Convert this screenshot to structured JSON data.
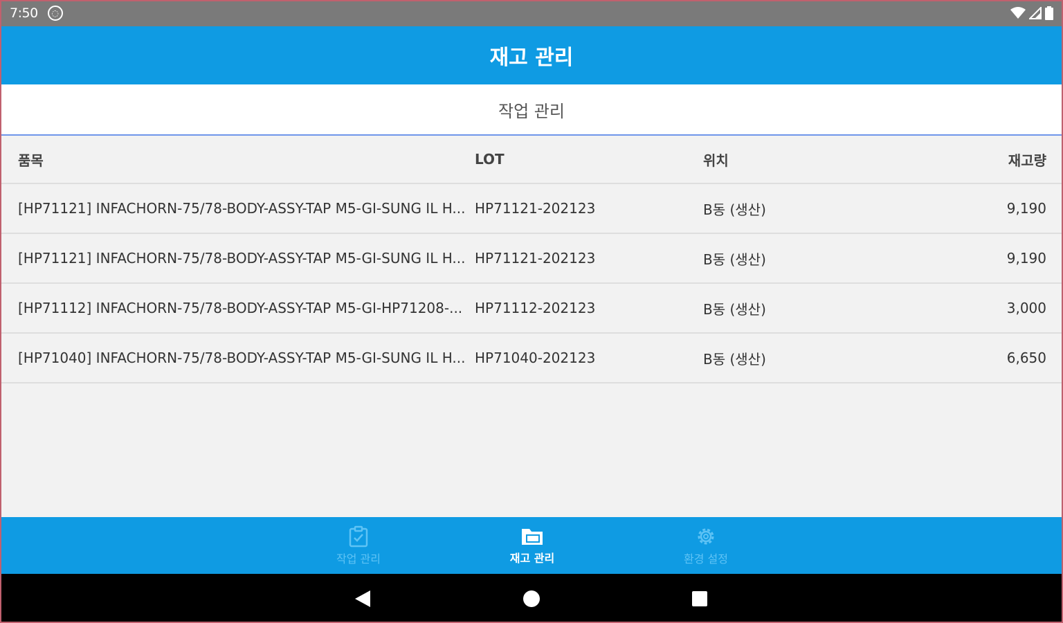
{
  "status_bar": {
    "time": "7:50",
    "notification_icon": "circle-app-icon",
    "icons": [
      "wifi-icon",
      "signal-icon",
      "battery-icon"
    ]
  },
  "app_bar": {
    "title": "재고 관리"
  },
  "sub_header": {
    "label": "작업 관리"
  },
  "table": {
    "headers": {
      "item": "품목",
      "lot": "LOT",
      "location": "위치",
      "quantity": "재고량"
    },
    "rows": [
      {
        "item": "[HP71121] INFACHORN-75/78-BODY-ASSY-TAP M5-GI-SUNG IL H...",
        "lot": "HP71121-202123",
        "location": "B동 (생산)",
        "quantity": "9,190"
      },
      {
        "item": "[HP71121] INFACHORN-75/78-BODY-ASSY-TAP M5-GI-SUNG IL H...",
        "lot": "HP71121-202123",
        "location": "B동 (생산)",
        "quantity": "9,190"
      },
      {
        "item": "[HP71112] INFACHORN-75/78-BODY-ASSY-TAP M5-GI-HP71208-...",
        "lot": "HP71112-202123",
        "location": "B동 (생산)",
        "quantity": "3,000"
      },
      {
        "item": "[HP71040] INFACHORN-75/78-BODY-ASSY-TAP M5-GI-SUNG IL H...",
        "lot": "HP71040-202123",
        "location": "B동 (생산)",
        "quantity": "6,650"
      }
    ]
  },
  "bottom_nav": {
    "items": [
      {
        "label": "작업 관리",
        "icon": "clipboard-check-icon",
        "active": false
      },
      {
        "label": "재고 관리",
        "icon": "folder-icon",
        "active": true
      },
      {
        "label": "환경 설정",
        "icon": "gear-icon",
        "active": false
      }
    ]
  },
  "colors": {
    "primary": "#0f9be3",
    "status_bar": "#7a7a7a",
    "inactive_nav": "#5fc3f5",
    "divider_accent": "#6f95ea"
  },
  "system_nav": {
    "icons": [
      "back-icon",
      "home-icon",
      "recents-icon"
    ]
  }
}
